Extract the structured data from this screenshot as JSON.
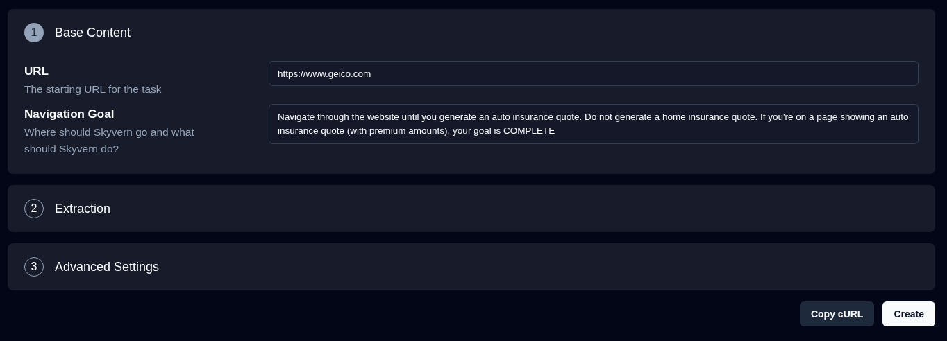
{
  "sections": [
    {
      "number": "1",
      "title": "Base Content",
      "expanded": true,
      "fields": [
        {
          "kind": "input",
          "label": "URL",
          "description": "The starting URL for the task",
          "value": "https://www.geico.com"
        },
        {
          "kind": "textarea",
          "label": "Navigation Goal",
          "description": "Where should Skyvern go and what should Skyvern do?",
          "value": "Navigate through the website until you generate an auto insurance quote. Do not generate a home insurance quote. If you're on a page showing an auto insurance quote (with premium amounts), your goal is COMPLETE"
        }
      ]
    },
    {
      "number": "2",
      "title": "Extraction",
      "expanded": false
    },
    {
      "number": "3",
      "title": "Advanced Settings",
      "expanded": false
    }
  ],
  "buttons": [
    {
      "label": "Copy cURL",
      "kind": "secondary"
    },
    {
      "label": "Create",
      "kind": "primary"
    }
  ]
}
